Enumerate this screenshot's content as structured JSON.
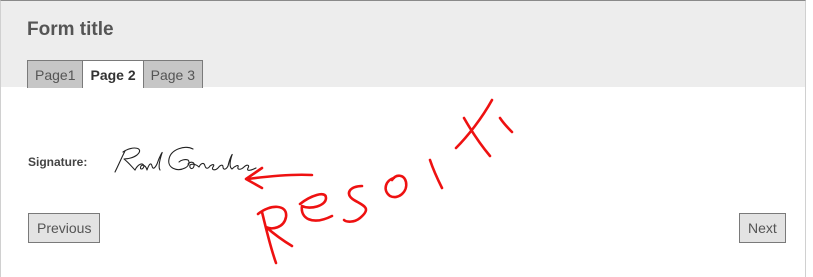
{
  "form": {
    "title": "Form title"
  },
  "tabs": [
    {
      "label": "Page1",
      "active": false
    },
    {
      "label": "Page 2",
      "active": true
    },
    {
      "label": "Page 3",
      "active": false
    }
  ],
  "signature": {
    "label": "Signature:",
    "signer": "Raul Gonzalez"
  },
  "nav": {
    "previous_label": "Previous",
    "next_label": "Next"
  },
  "annotation": {
    "text": "RESOLX",
    "color": "#ee1111"
  },
  "colors": {
    "header_bg": "#ededed",
    "tab_bg": "#c6c6c6",
    "button_bg": "#e3e3e3"
  }
}
